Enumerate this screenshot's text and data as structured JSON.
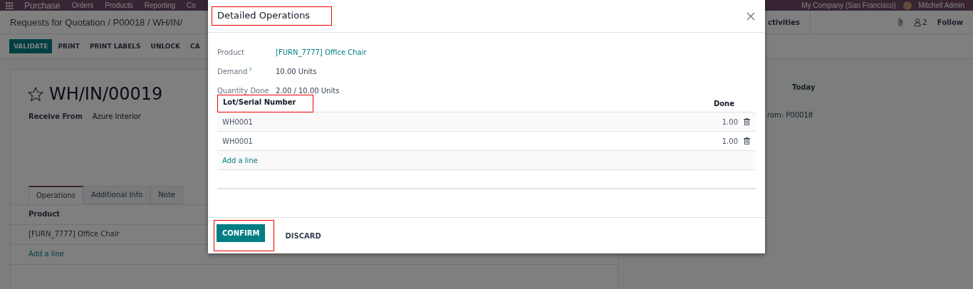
{
  "navbar": {
    "app": "Purchase",
    "menu": [
      "Orders",
      "Products",
      "Reporting",
      "Co"
    ],
    "company": "My Company (San Francisco)",
    "user": "Mitchell Admin"
  },
  "breadcrumb": "Requests for Quotation / P00018 / WH/IN/",
  "control_panel": {
    "activities": "ctivities",
    "followers": "2",
    "follow": "Follow"
  },
  "buttons": [
    {
      "label": "VALIDATE",
      "primary": true
    },
    {
      "label": "PRINT",
      "primary": false
    },
    {
      "label": "PRINT LABELS",
      "primary": false
    },
    {
      "label": "UNLOCK",
      "primary": false
    },
    {
      "label": "CA",
      "primary": false
    }
  ],
  "record": {
    "starred": false,
    "name": "WH/IN/00019",
    "fields": [
      {
        "label": "Receive From",
        "value": "Azure Interior"
      }
    ],
    "tabs": [
      {
        "label": "Operations",
        "selected": true
      },
      {
        "label": "Additional Info",
        "selected": false
      },
      {
        "label": "Note",
        "selected": false
      }
    ],
    "table": {
      "columns": [
        "Product"
      ],
      "rows": [
        "[FURN_7777] Office Chair"
      ],
      "add_line": "Add a line"
    }
  },
  "chatter": {
    "date": "Today",
    "message": "rom: P00018"
  },
  "dialog": {
    "title": {
      "text": "Detailed Operations",
      "highlighted": true
    },
    "fields": [
      {
        "label": "Product",
        "value": "[FURN_7777] Office Chair",
        "link": true
      },
      {
        "label": "Demand",
        "help": "?",
        "value": "10.00 Units",
        "link": false
      },
      {
        "label": "Quantity Done",
        "value": "2.00 / 10.00 Units",
        "link": false
      }
    ],
    "table": {
      "columns": [
        {
          "label": "Lot/Serial Number",
          "highlighted": true
        },
        {
          "label": "Done",
          "highlighted": false
        }
      ],
      "rows": [
        {
          "lot": "WH0001",
          "done": "1.00"
        },
        {
          "lot": "WH0001",
          "done": "1.00"
        }
      ],
      "add_line": "Add a line"
    },
    "buttons": [
      {
        "label": "CONFIRM",
        "primary": true,
        "highlighted": true
      },
      {
        "label": "DISCARD",
        "primary": false,
        "highlighted": false
      }
    ]
  }
}
